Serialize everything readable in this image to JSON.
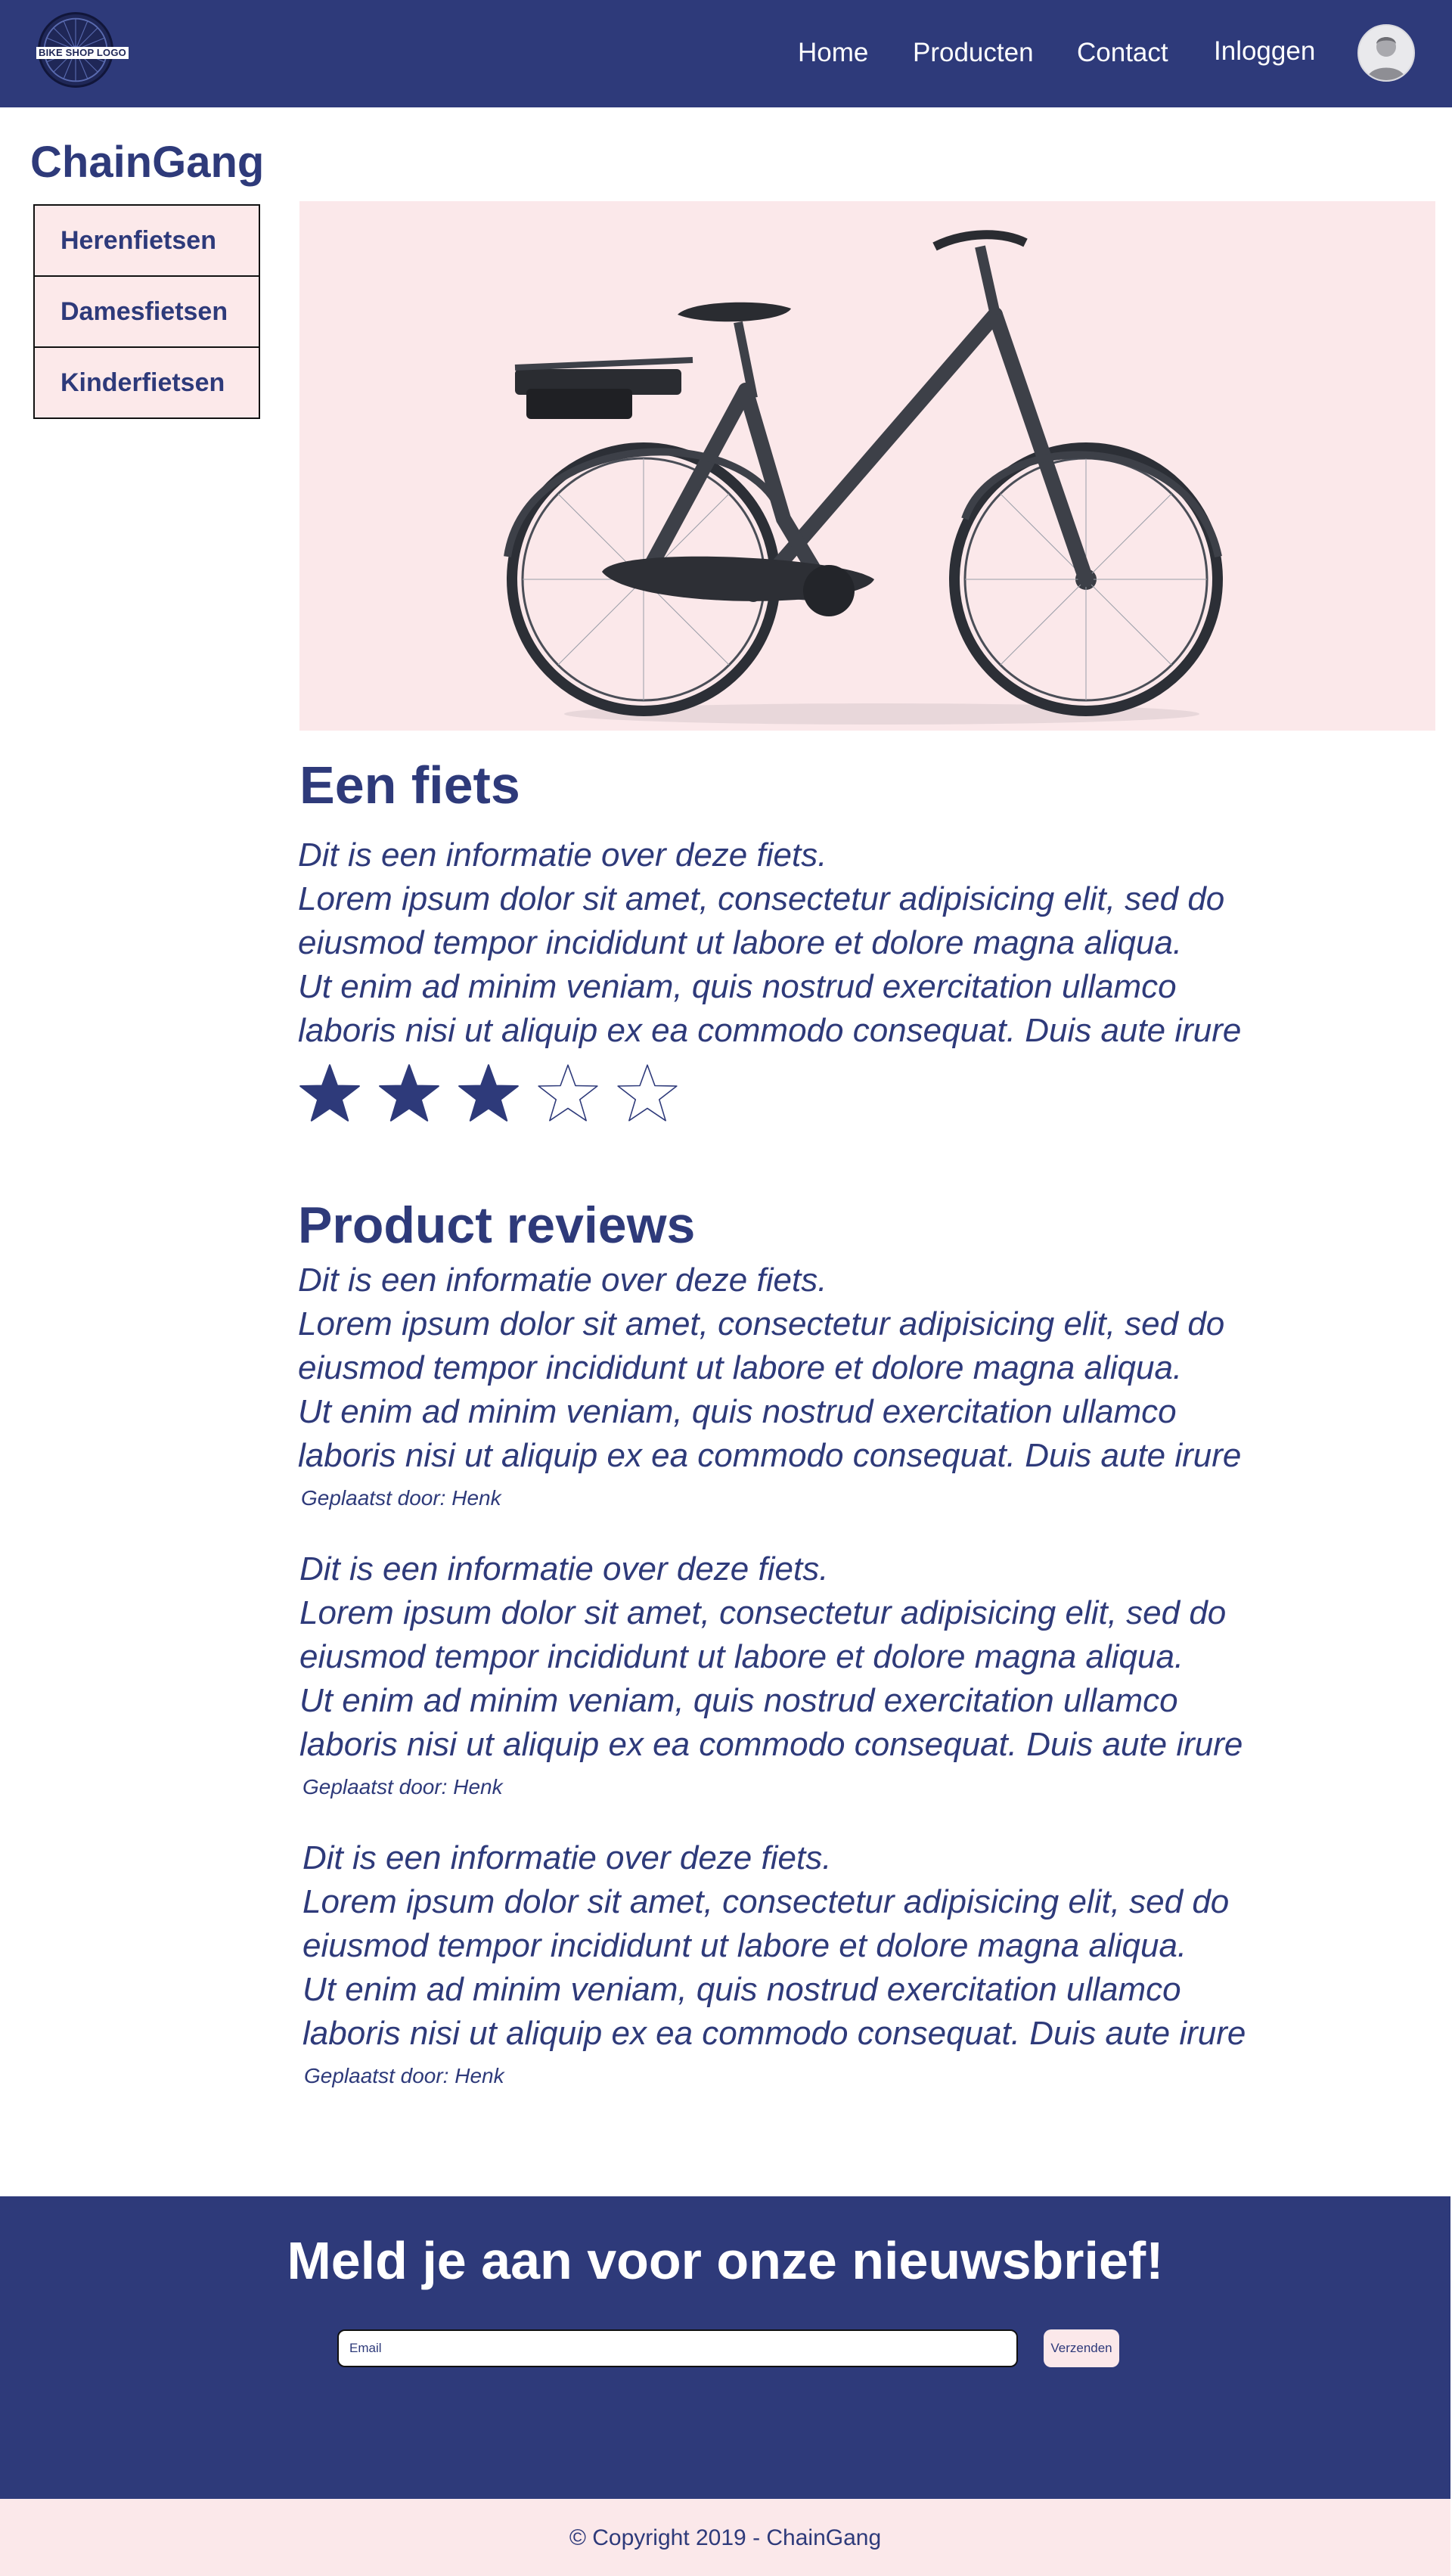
{
  "header": {
    "logo_text": "BIKE SHOP LOGO",
    "nav": [
      {
        "label": "Home"
      },
      {
        "label": "Producten"
      },
      {
        "label": "Contact"
      },
      {
        "label": "Inloggen"
      }
    ]
  },
  "brand": "ChainGang",
  "sidebar": {
    "items": [
      {
        "label": "Herenfietsen"
      },
      {
        "label": "Damesfietsen"
      },
      {
        "label": "Kinderfietsen"
      }
    ]
  },
  "product": {
    "title": "Een fiets",
    "description": [
      "Dit is een informatie over deze fiets.",
      "Lorem ipsum dolor sit amet, consectetur adipisicing elit, sed do",
      "eiusmod tempor incididunt ut labore et dolore magna aliqua.",
      "Ut enim ad minim veniam, quis nostrud exercitation ullamco",
      "laboris nisi ut aliquip ex ea commodo consequat. Duis aute irure"
    ],
    "rating": 3,
    "rating_max": 5
  },
  "reviews": {
    "title": "Product reviews",
    "items": [
      {
        "lines": [
          "Dit is een informatie over deze fiets.",
          "Lorem ipsum dolor sit amet, consectetur adipisicing elit, sed do",
          "eiusmod tempor incididunt ut labore et dolore magna aliqua.",
          "Ut enim ad minim veniam, quis nostrud exercitation ullamco",
          "laboris nisi ut aliquip ex ea commodo consequat. Duis aute irure"
        ],
        "byline": "Geplaatst door: Henk"
      },
      {
        "lines": [
          "Dit is een informatie over deze fiets.",
          "Lorem ipsum dolor sit amet, consectetur adipisicing elit, sed do",
          "eiusmod tempor incididunt ut labore et dolore magna aliqua.",
          "Ut enim ad minim veniam, quis nostrud exercitation ullamco",
          "laboris nisi ut aliquip ex ea commodo consequat. Duis aute irure"
        ],
        "byline": "Geplaatst door: Henk"
      },
      {
        "lines": [
          "Dit is een informatie over deze fiets.",
          "Lorem ipsum dolor sit amet, consectetur adipisicing elit, sed do",
          "eiusmod tempor incididunt ut labore et dolore magna aliqua.",
          "Ut enim ad minim veniam, quis nostrud exercitation ullamco",
          "laboris nisi ut aliquip ex ea commodo consequat. Duis aute irure"
        ],
        "byline": "Geplaatst door: Henk"
      }
    ]
  },
  "newsletter": {
    "title": "Meld je aan voor onze nieuwsbrief!",
    "email_placeholder": "Email",
    "submit_label": "Verzenden"
  },
  "footer": {
    "copyright": "© Copyright 2019 - ChainGang"
  },
  "colors": {
    "primary": "#2e3a7a",
    "light_pink": "#fbe8ea",
    "sidebar_bg": "#fce9ea",
    "white": "#ffffff"
  },
  "icons": {
    "avatar": "user-avatar-icon",
    "star_filled": "star-filled-icon",
    "star_empty": "star-outline-icon"
  }
}
